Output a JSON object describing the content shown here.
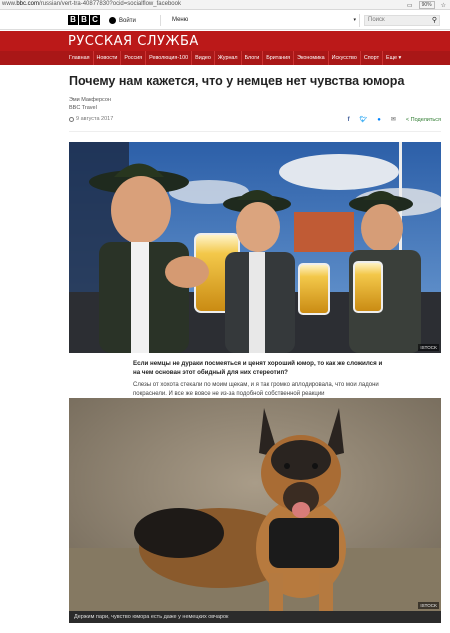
{
  "browser": {
    "url_prefix": "www.",
    "url_host": "bbc.com",
    "url_path": "/russian/vert-tra-40877830?ocid=socialflow_facebook",
    "zoom": "90%"
  },
  "global_bar": {
    "logo_letters": [
      "B",
      "B",
      "C"
    ],
    "signin_label": "Войти",
    "menu_label": "Меню",
    "search_placeholder": "Поиск"
  },
  "masthead": {
    "title": "РУССКАЯ СЛУЖБА",
    "color": "#bb1919"
  },
  "nav": {
    "items": [
      "Главная",
      "Новости",
      "Россия",
      "Революция-100",
      "Видео",
      "Журнал",
      "Блоги",
      "Британия",
      "Экономика",
      "Искусство",
      "Спорт",
      "Еще ▾"
    ]
  },
  "article": {
    "headline": "Почему нам кажется, что у немцев нет чувства юмора",
    "author": "Эми Макферсон",
    "outlet": "BBC Travel",
    "date": "9 августа 2017",
    "share_label": "Поделиться",
    "share_icons": [
      "facebook-icon",
      "twitter-icon",
      "messenger-icon",
      "email-icon",
      "share-icon"
    ],
    "photo1_credit": "ISTOCK",
    "lead": "Если немцы не дураки посмеяться и ценят хороший юмор, то как же сложился и на чем основан этот обидный для них стереотип?",
    "body": "Слезы от хохота стекали по моим щекам, и я так громко аплодировала, что мои ладони покраснели. И все же вовсе не из-за подобной собственной реакции",
    "photo2_credit": "ISTOCK",
    "photo2_caption": "Держим пари, чувство юмора есть даже у немецких овчарок"
  }
}
